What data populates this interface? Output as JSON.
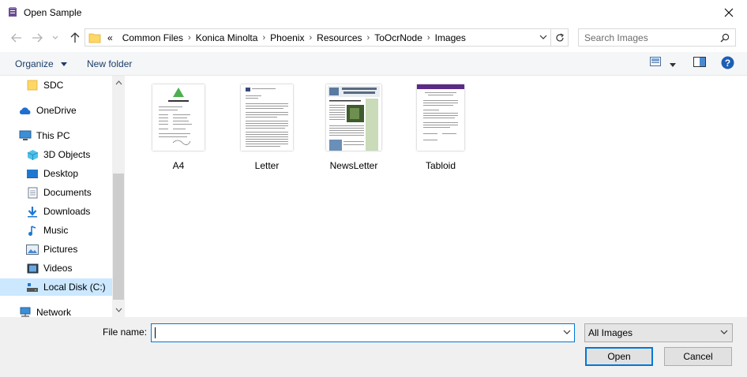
{
  "window": {
    "title": "Open Sample"
  },
  "address": {
    "overflow": "«",
    "crumbs": [
      "Common Files",
      "Konica Minolta",
      "Phoenix",
      "Resources",
      "ToOcrNode",
      "Images"
    ]
  },
  "search": {
    "placeholder": "Search Images"
  },
  "toolbar": {
    "organize": "Organize",
    "new_folder": "New folder"
  },
  "sidebar": {
    "items": [
      {
        "label": "SDC",
        "icon": "folder-icon"
      },
      {
        "label": "OneDrive",
        "icon": "cloud-icon"
      },
      {
        "label": "This PC",
        "icon": "computer-icon"
      },
      {
        "label": "3D Objects",
        "icon": "cube-icon"
      },
      {
        "label": "Desktop",
        "icon": "desktop-icon"
      },
      {
        "label": "Documents",
        "icon": "documents-icon"
      },
      {
        "label": "Downloads",
        "icon": "download-icon"
      },
      {
        "label": "Music",
        "icon": "music-icon"
      },
      {
        "label": "Pictures",
        "icon": "pictures-icon"
      },
      {
        "label": "Videos",
        "icon": "videos-icon"
      },
      {
        "label": "Local Disk (C:)",
        "icon": "disk-icon"
      },
      {
        "label": "Network",
        "icon": "network-icon"
      }
    ]
  },
  "files": [
    {
      "name": "A4"
    },
    {
      "name": "Letter"
    },
    {
      "name": "NewsLetter"
    },
    {
      "name": "Tabloid"
    }
  ],
  "footer": {
    "file_name_label": "File name:",
    "file_name_value": "",
    "filter": "All Images",
    "open": "Open",
    "cancel": "Cancel"
  },
  "colors": {
    "accent": "#0078d7",
    "selected": "#cce8ff",
    "link": "#1a3d6b"
  }
}
